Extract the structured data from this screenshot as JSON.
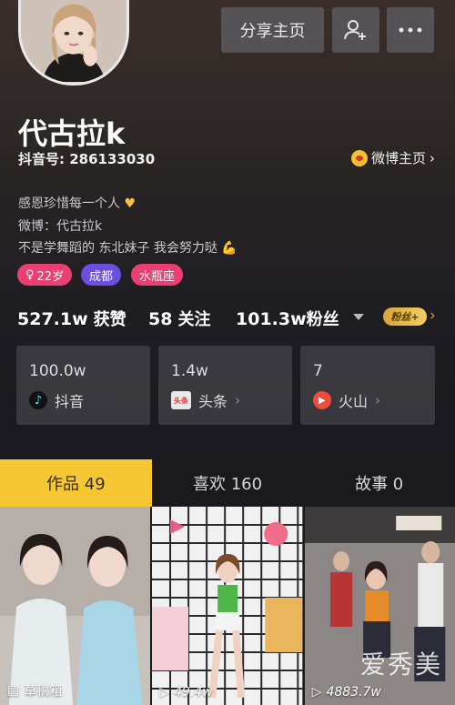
{
  "header": {
    "share_label": "分享主页",
    "add_friend_icon": "add-friend-icon",
    "more_icon": "more-icon"
  },
  "profile": {
    "nickname": "代古拉k",
    "account": "抖音号: 286133030",
    "weibo_link": "微博主页",
    "bio": [
      "感恩珍惜每一个人",
      "微博：代古拉k",
      "不是学舞蹈的 东北妹子 我会努力哒"
    ],
    "tags": [
      {
        "label": "22岁",
        "color": "#ea3f73"
      },
      {
        "label": "成都",
        "color": "#6b4fe0"
      },
      {
        "label": "水瓶座",
        "color": "#ea3f73"
      }
    ]
  },
  "stats": {
    "likes_value": "527.1w",
    "likes_label": "获赞",
    "following_value": "58",
    "following_label": "关注",
    "fans_value": "101.3w",
    "fans_label": "粉丝",
    "fan_badge": "粉丝+"
  },
  "platforms": [
    {
      "count": "100.0w",
      "name": "抖音",
      "icon": "douyin-icon"
    },
    {
      "count": "1.4w",
      "name": "头条",
      "icon": "toutiao-icon",
      "icon_text": "头条"
    },
    {
      "count": "7",
      "name": "火山",
      "icon": "huoshan-icon"
    }
  ],
  "tabs": [
    {
      "label": "作品 49",
      "active": true
    },
    {
      "label": "喜欢 160",
      "active": false
    },
    {
      "label": "故事 0",
      "active": false
    }
  ],
  "videos": [
    {
      "meta": "草稿箱",
      "icon": "draft-icon"
    },
    {
      "meta": "49.4w",
      "icon": "play-icon"
    },
    {
      "meta": "4883.7w",
      "icon": "play-icon"
    }
  ],
  "watermark": "爱秀美",
  "colors": {
    "accent": "#f5c833",
    "tag_pink": "#ea3f73",
    "tag_purple": "#6b4fe0"
  }
}
